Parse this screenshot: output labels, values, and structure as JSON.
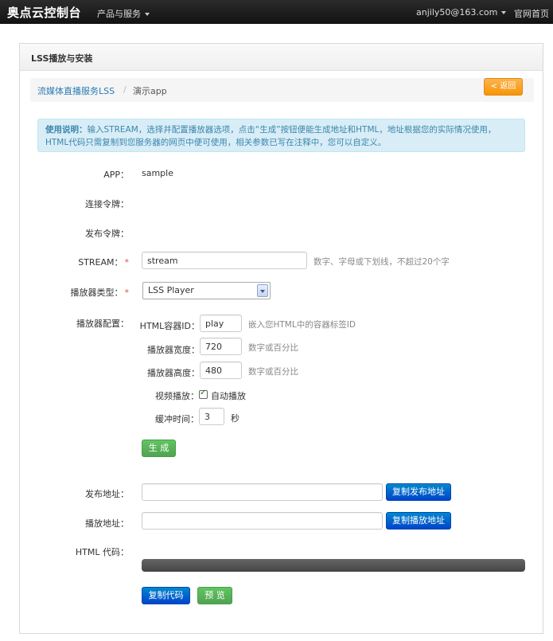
{
  "topnav": {
    "brand": "奥点云控制台",
    "products": "产品与服务",
    "user": "anjily50@163.com",
    "home": "官网首页"
  },
  "panel": {
    "title": "LSS播放与安装"
  },
  "breadcrumb": {
    "parent": "流媒体直播服务LSS",
    "separator": "/",
    "current": "演示app",
    "back_label": "< 返回"
  },
  "alert": {
    "lead": "使用说明：",
    "text": "输入STREAM，选择并配置播放器选项，点击“生成”按钮便能生成地址和HTML，地址根据您的实际情况使用，HTML代码只需复制到您服务器的网页中便可使用，相关参数已写在注释中，您可以自定义。"
  },
  "form": {
    "app_label": "APP：",
    "app_value": "sample",
    "token_label": "连接令牌：",
    "pub_token_label": "发布令牌：",
    "stream_label": "STREAM：",
    "stream_value": "stream",
    "stream_hint": "数字、字母或下划线，不超过20个字",
    "player_type_label": "播放器类型：",
    "player_type_value": "LSS Player",
    "player_config_label": "播放器配置：",
    "container_label": "HTML容器ID：",
    "container_value": "play",
    "container_hint": "嵌入您HTML中的容器标签ID",
    "width_label": "播放器宽度：",
    "width_value": "720",
    "width_hint": "数字或百分比",
    "height_label": "播放器高度：",
    "height_value": "480",
    "height_hint": "数字或百分比",
    "video_label": "视频播放：",
    "autoplay_label": "自动播放",
    "buffer_label": "缓冲时间：",
    "buffer_value": "3",
    "buffer_unit": "秒",
    "generate_label": "生 成",
    "publish_label": "发布地址：",
    "publish_value": "",
    "copy_publish_label": "复制发布地址",
    "play_label": "播放地址：",
    "play_value": "",
    "copy_play_label": "复制播放地址",
    "html_label": "HTML 代码：",
    "copy_code_label": "复制代码",
    "preview_label": "预 览"
  },
  "required_mark": "*"
}
